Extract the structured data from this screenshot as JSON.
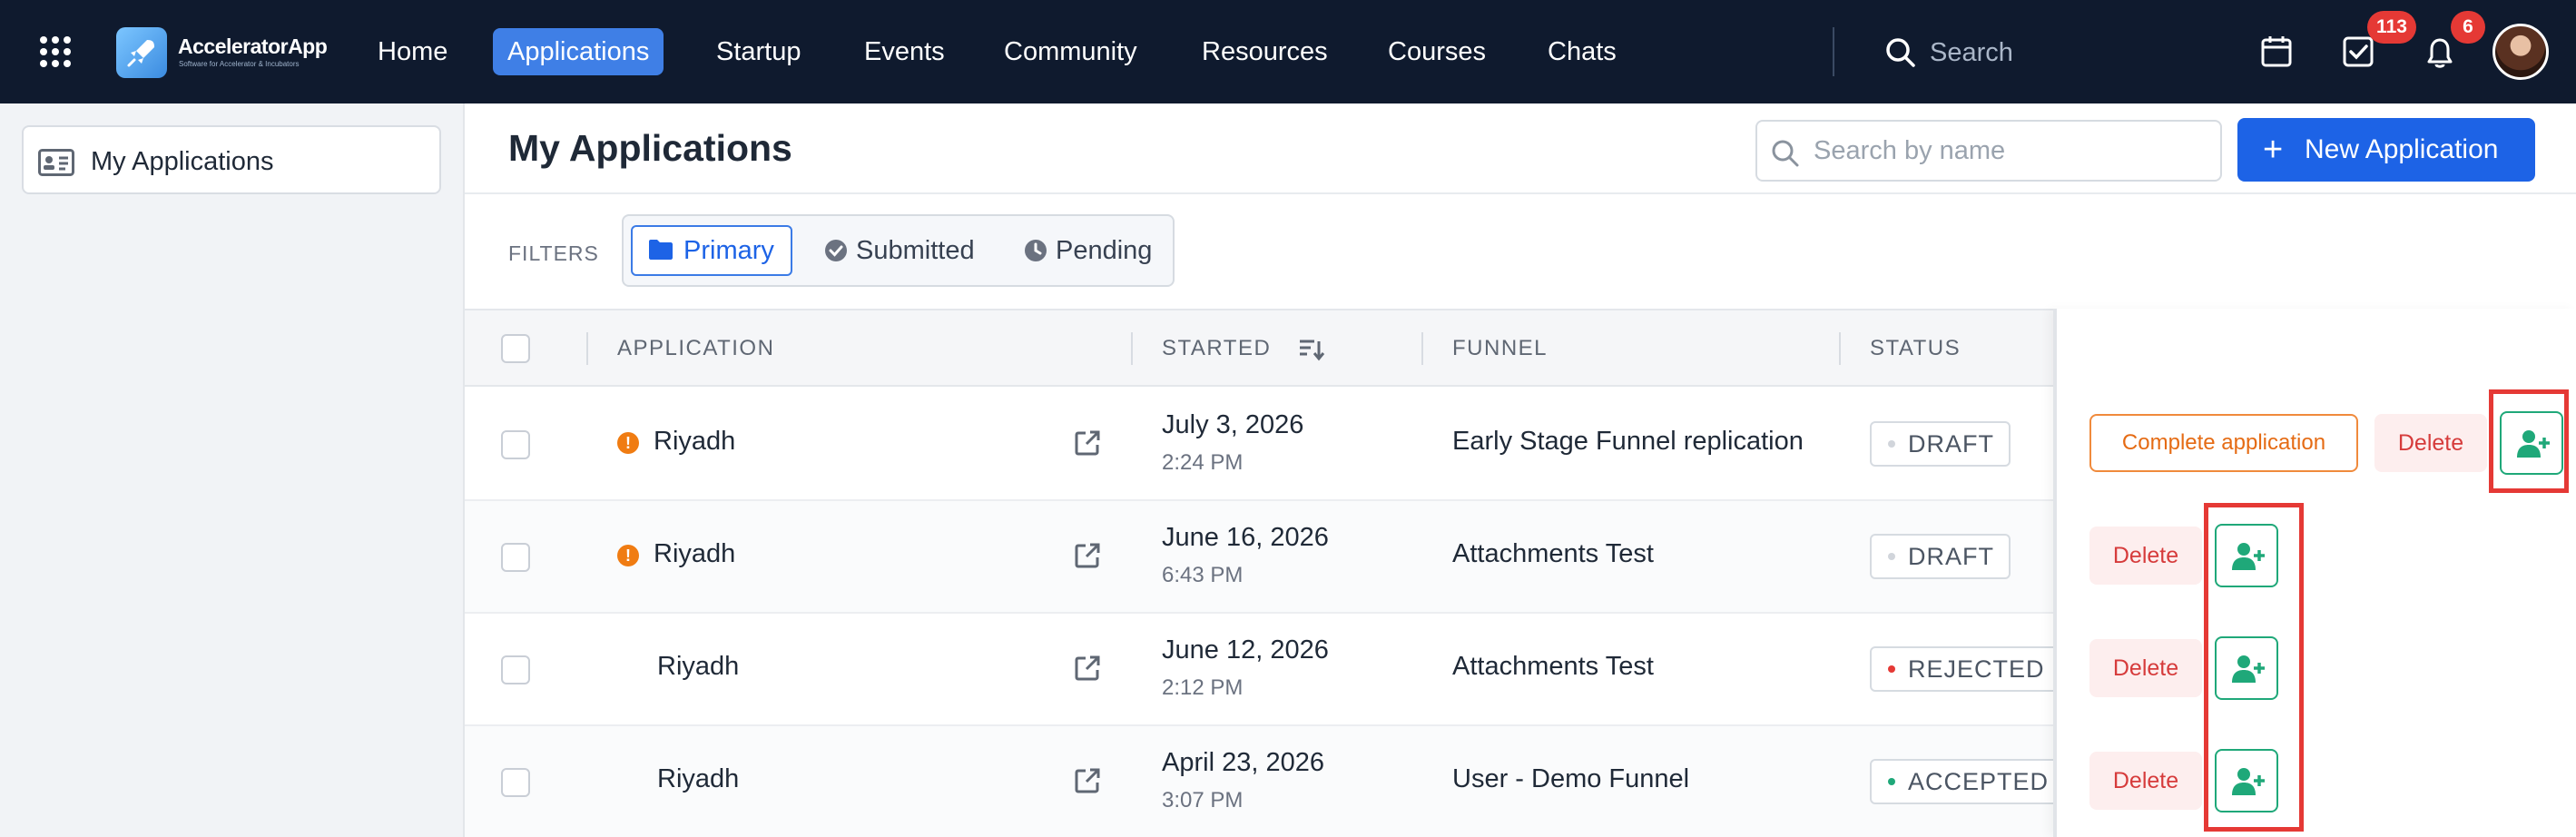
{
  "navbar": {
    "app_menu_icon": "grid-icon",
    "logo": {
      "title": "AcceleratorApp",
      "subtitle": "Software for Accelerator & Incubators",
      "icon": "rocket-icon"
    },
    "links": [
      {
        "label": "Home",
        "active": false
      },
      {
        "label": "Applications",
        "active": true
      },
      {
        "label": "Startup",
        "active": false
      },
      {
        "label": "Events",
        "active": false
      },
      {
        "label": "Community",
        "active": false
      },
      {
        "label": "Resources",
        "active": false
      },
      {
        "label": "Courses",
        "active": false
      },
      {
        "label": "Chats",
        "active": false
      }
    ],
    "search_label": "Search",
    "tasks_badge": "113",
    "notifications_badge": "6"
  },
  "sidebar": {
    "items": [
      {
        "label": "My Applications",
        "icon": "id-card-icon"
      }
    ]
  },
  "main": {
    "title": "My Applications",
    "search_placeholder": "Search by name",
    "new_button_label": "New Application",
    "filters_label": "FILTERS",
    "filters": [
      {
        "label": "Primary",
        "icon": "folder-icon",
        "active": true
      },
      {
        "label": "Submitted",
        "icon": "check-circle-icon",
        "active": false
      },
      {
        "label": "Pending",
        "icon": "clock-icon",
        "active": false
      }
    ]
  },
  "table": {
    "columns": {
      "application": "APPLICATION",
      "started": "STARTED",
      "funnel": "FUNNEL",
      "status": "STATUS"
    },
    "rows": [
      {
        "application": "Riyadh",
        "warning": true,
        "date": "July 3, 2026",
        "time": "2:24 PM",
        "funnel": "Early Stage Funnel replication",
        "status": "DRAFT",
        "complete_label": "Complete application",
        "delete_label": "Delete"
      },
      {
        "application": "Riyadh",
        "warning": true,
        "date": "June 16, 2026",
        "time": "6:43 PM",
        "funnel": "Attachments Test",
        "status": "DRAFT",
        "delete_label": "Delete"
      },
      {
        "application": "Riyadh",
        "warning": false,
        "date": "June 12, 2026",
        "time": "2:12 PM",
        "funnel": "Attachments Test",
        "status": "REJECTED",
        "delete_label": "Delete"
      },
      {
        "application": "Riyadh",
        "warning": false,
        "date": "April 23, 2026",
        "time": "3:07 PM",
        "funnel": "User - Demo Funnel",
        "status": "ACCEPTED",
        "delete_label": "Delete"
      }
    ]
  },
  "colors": {
    "navbar_bg": "#0f1a2e",
    "accent": "#1d63e6",
    "draft_dot": "#d1d5db",
    "rejected_dot": "#e53935",
    "accepted_dot": "#1fa879",
    "highlight": "#e53935"
  }
}
